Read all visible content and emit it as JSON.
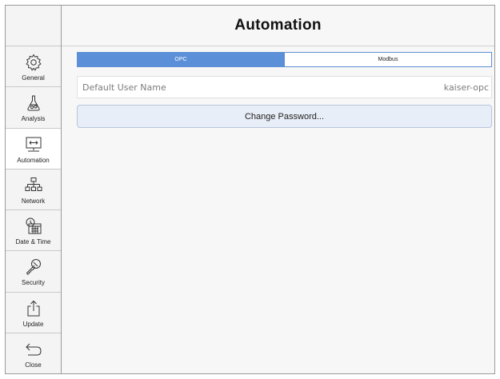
{
  "page": {
    "title": "Automation"
  },
  "sidebar": {
    "items": [
      {
        "label": "General",
        "icon": "gear-icon"
      },
      {
        "label": "Analysis",
        "icon": "flask-icon"
      },
      {
        "label": "Automation",
        "icon": "monitor-arrows-icon",
        "active": true
      },
      {
        "label": "Network",
        "icon": "network-icon"
      },
      {
        "label": "Date & Time",
        "icon": "calendar-clock-icon"
      },
      {
        "label": "Security",
        "icon": "key-icon"
      },
      {
        "label": "Update",
        "icon": "upload-icon"
      },
      {
        "label": "Close",
        "icon": "back-arrow-icon"
      }
    ]
  },
  "tabs": {
    "opc": "OPC",
    "modbus": "Modbus",
    "selected": "OPC"
  },
  "settings": {
    "user_label": "Default User Name",
    "user_value": "kaiser-opc",
    "change_password": "Change Password..."
  },
  "colors": {
    "accent": "#5b8fd8",
    "button_bg": "#e8eef7",
    "panel_bg": "#f7f7f7"
  }
}
